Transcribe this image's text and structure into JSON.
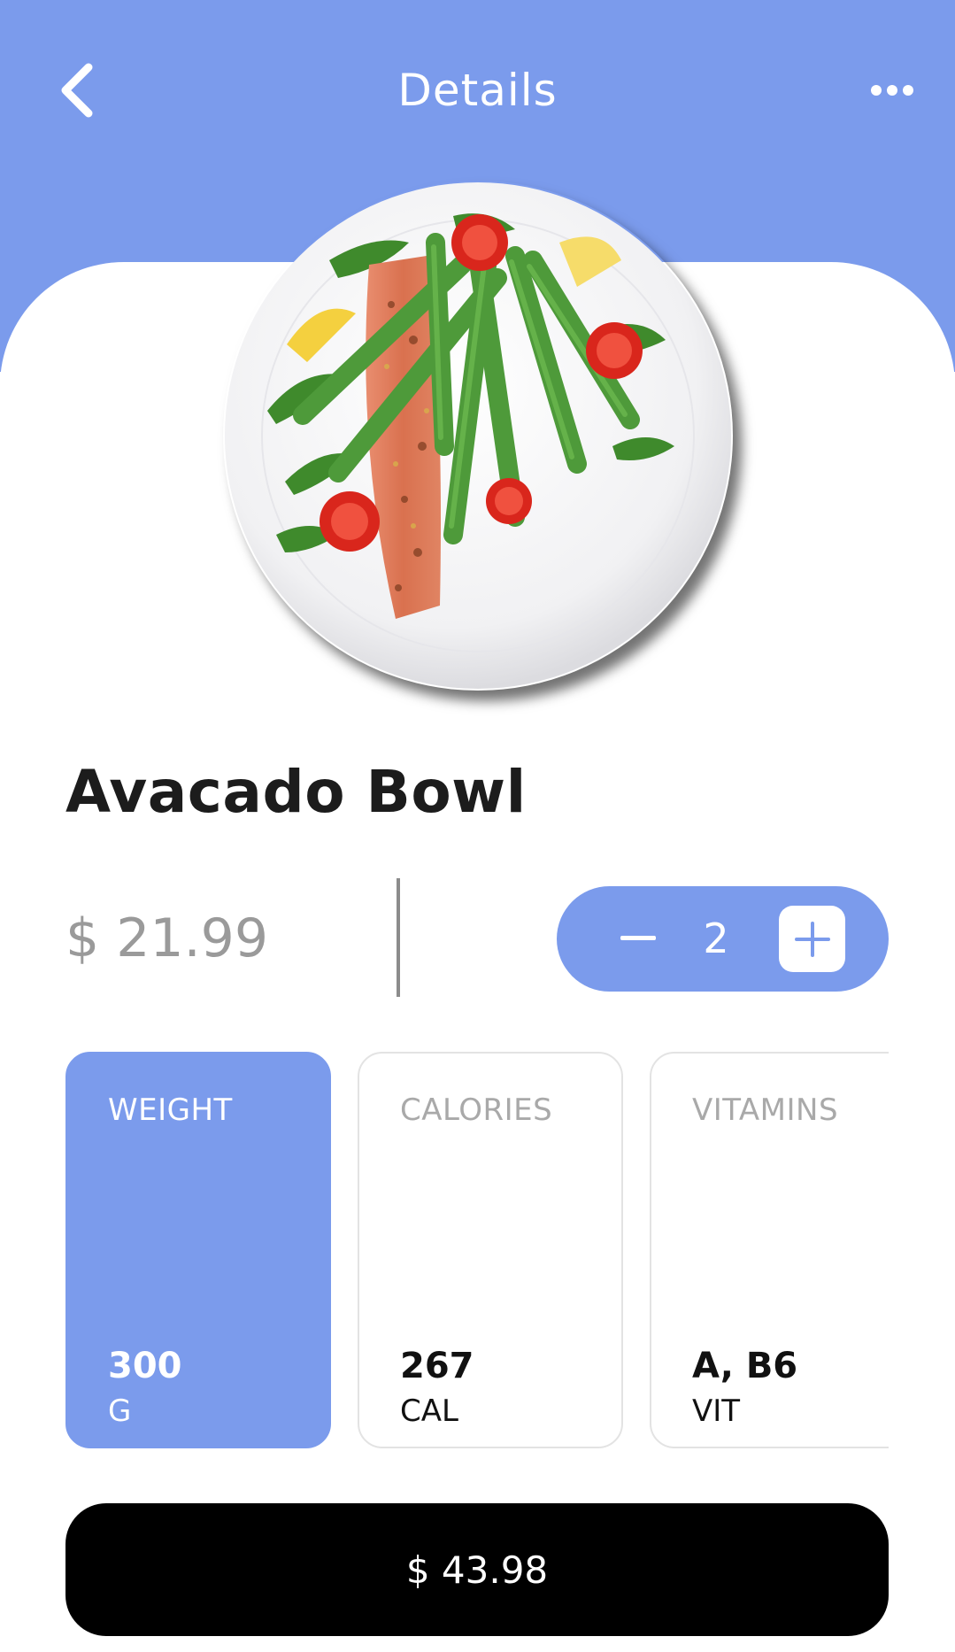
{
  "colors": {
    "accent": "#7b9bec",
    "checkout": "#000000"
  },
  "header": {
    "title": "Details",
    "back_icon": "chevron-left-icon",
    "more_icon": "more-horizontal-icon"
  },
  "product": {
    "name": "Avacado Bowl",
    "price": "$ 21.99",
    "quantity": "2"
  },
  "stepper": {
    "minus_icon": "minus-icon",
    "plus_icon": "plus-icon"
  },
  "nutrition": [
    {
      "label": "WEIGHT",
      "value": "300",
      "unit": "G",
      "selected": true
    },
    {
      "label": "CALORIES",
      "value": "267",
      "unit": "CAL",
      "selected": false
    },
    {
      "label": "VITAMINS",
      "value": "A, B6",
      "unit": "VIT",
      "selected": false
    }
  ],
  "checkout": {
    "total": "$ 43.98"
  }
}
